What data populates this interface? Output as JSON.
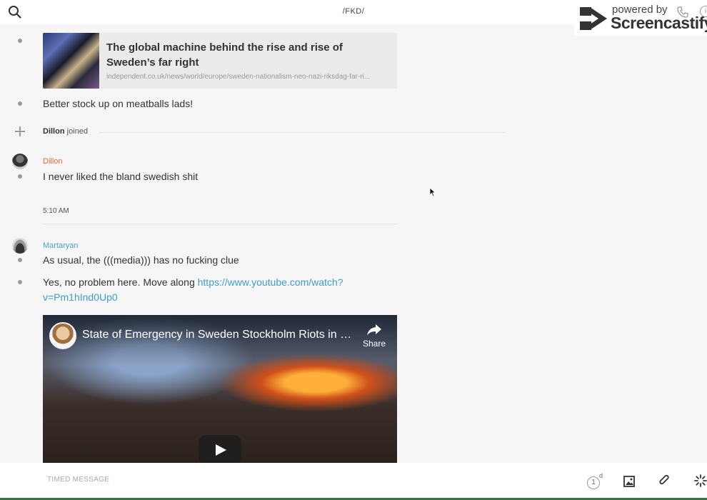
{
  "header": {
    "channel": "/FKD/",
    "search_icon": "search-icon"
  },
  "watermark": {
    "powered": "powered by",
    "brand": "Screencastify",
    "info": "i"
  },
  "link_card": {
    "title": "The global machine behind the rise and rise of Sweden’s far right",
    "url": "independent.co.uk/news/world/europe/sweden-nationalism-neo-nazi-riksdag-far-ri..."
  },
  "messages": {
    "m1": "Better stock up on meatballs lads!",
    "join_user": "Dillon",
    "join_text": " joined",
    "dillon_name": "Dillon",
    "dillon_color": "#e2693a",
    "m2": "I never liked the bland swedish shit",
    "time": "5:10 AM",
    "martaryan_name": "Martaryan",
    "martaryan_color": "#4aa0cf",
    "m3": "As usual, the (((media))) has no fucking clue",
    "m4_prefix": "Yes, no problem here. Move along ",
    "m4_link": "https://www.youtube.com/watch?v=Pm1hInd0Up0"
  },
  "video": {
    "title": "State of Emergency in Sweden Stockholm Riots in R...",
    "share": "Share"
  },
  "composer": {
    "placeholder": "TIMED MESSAGE",
    "timer_value": "1",
    "timer_unit": "d"
  }
}
